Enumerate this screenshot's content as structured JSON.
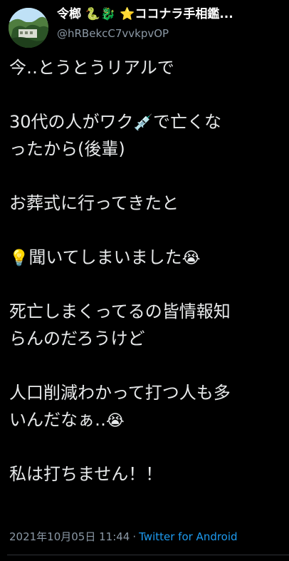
{
  "header": {
    "display_name": "令榔 🐍🐉 ⭐ココナラ手相鑑...",
    "handle": "@hRBekcC7vvkpvOP"
  },
  "tweet": {
    "line1": "今‥とうとうリアルで",
    "p2a": "30代の人がワク",
    "p2_emoji": "💉",
    "p2b": "で亡くな",
    "p2c": "ったから(後輩)",
    "p3": "お葬式に行ってきたと",
    "p4_emoji_start": "💡",
    "p4": "聞いてしまいました",
    "p4_emoji_end": "😭",
    "p5a": "死亡しまくってるの皆情報知",
    "p5b": "らんのだろうけど",
    "p6a": "人口削減わかって打つ人も多",
    "p6b": "いんだなぁ‥",
    "p6_emoji": "😭",
    "p7": "私は打ちません！！"
  },
  "meta": {
    "timestamp": "2021年10月05日 11:44",
    "separator": "·",
    "source": "Twitter for Android"
  },
  "colors": {
    "background": "#000000",
    "text": "#e7e9ea",
    "secondary": "#8b98a5",
    "link": "#1d9bf0",
    "divider": "#2f3336"
  }
}
